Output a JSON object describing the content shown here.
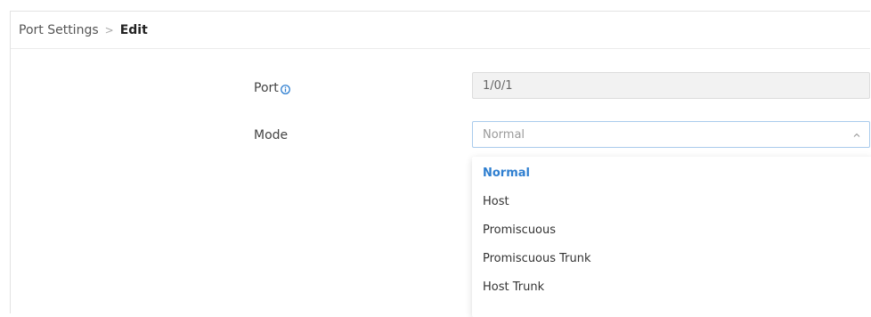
{
  "breadcrumb": {
    "root": "Port Settings",
    "separator": ">",
    "current": "Edit"
  },
  "form": {
    "port": {
      "label": "Port",
      "info_icon": "info-circle-icon",
      "value": "1/0/1",
      "disabled": true
    },
    "mode": {
      "label": "Mode",
      "selected": "Normal",
      "open": true,
      "options": [
        "Normal",
        "Host",
        "Promiscuous",
        "Promiscuous Trunk",
        "Host Trunk"
      ]
    }
  },
  "colors": {
    "accent": "#2f7fd0",
    "focus_border": "#a9cbec",
    "disabled_bg": "#f2f2f2"
  }
}
